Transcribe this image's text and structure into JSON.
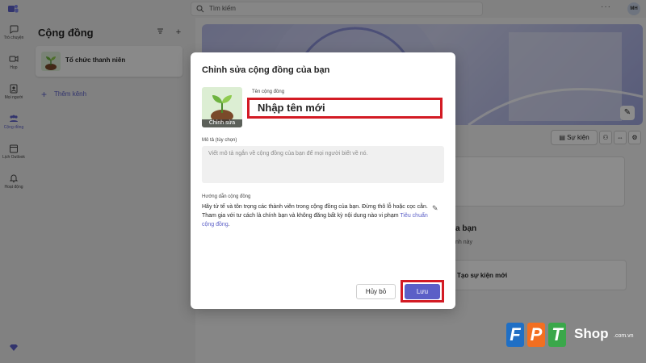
{
  "search": {
    "placeholder": "Tìm kiếm"
  },
  "user": {
    "initials": "MH"
  },
  "rail": {
    "items": [
      {
        "label": "Trò chuyện",
        "icon": "chat-icon"
      },
      {
        "label": "Họp",
        "icon": "video-icon"
      },
      {
        "label": "Mọi người",
        "icon": "people-icon"
      },
      {
        "label": "Cộng đồng",
        "icon": "community-icon",
        "active": true
      },
      {
        "label": "Lịch Outlook",
        "icon": "calendar-icon"
      },
      {
        "label": "Hoạt động",
        "icon": "bell-icon"
      }
    ]
  },
  "panel": {
    "title": "Cộng đồng",
    "community_name": "Tổ chức thanh niên",
    "add_channel": "Thêm kênh"
  },
  "main": {
    "event_button": "Sự kiện",
    "heading_fragment": "a bạn",
    "sub_fragment": "nh này",
    "create_event": "Tạo sự kiện mới"
  },
  "dialog": {
    "title": "Chỉnh sửa cộng đồng của bạn",
    "image_edit_label": "Chỉnh sửa",
    "name_label": "Tên cộng đồng",
    "name_value": "Nhập tên mới",
    "desc_label": "Mô tả (tùy chọn)",
    "desc_placeholder": "Viết mô tả ngắn về cộng đồng của bạn để mọi người biết về nó.",
    "guide_label": "Hướng dẫn cộng đồng",
    "guide_text": "Hãy tử tế và tôn trọng các thành viên trong cộng đồng của bạn. Đừng thô lỗ hoặc cọc cằn. Tham gia với tư cách là chính bạn và không đăng bất kỳ nội dung nào vi phạm",
    "guide_link": "Tiêu chuẩn cộng đồng",
    "guide_end": ".",
    "cancel_label": "Hủy bỏ",
    "save_label": "Lưu"
  },
  "watermark": {
    "letters": [
      "F",
      "P",
      "T"
    ],
    "shop": "Shop",
    "domain": ".com.vn"
  },
  "colors": {
    "accent": "#5b5fc7",
    "highlight": "#d31b24",
    "fpt_blue": "#1f6fc5",
    "fpt_orange": "#f36f21",
    "fpt_green": "#3aa74a"
  }
}
